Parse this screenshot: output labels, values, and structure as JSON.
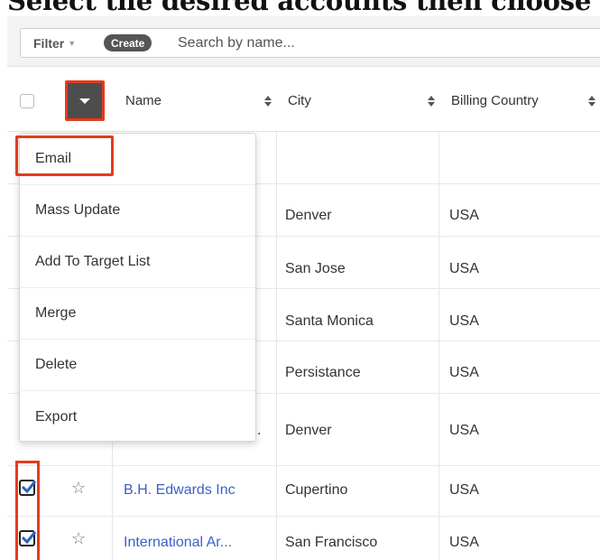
{
  "caption": "Select the desired accounts then choose",
  "toolbar": {
    "filter_label": "Filter",
    "create_label": "Create",
    "search_placeholder": "Search by name..."
  },
  "columns": {
    "name": "Name",
    "city": "City",
    "country": "Billing Country"
  },
  "mass_actions_menu": [
    "Email",
    "Mass Update",
    "Add To Target List",
    "Merge",
    "Delete",
    "Export"
  ],
  "rows": [
    {
      "name": "",
      "city": "Denver",
      "country": "USA"
    },
    {
      "name": "",
      "city": "San Jose",
      "country": "USA"
    },
    {
      "name": "",
      "city": "Santa Monica",
      "country": "USA"
    },
    {
      "name": "",
      "city": "Persistance",
      "country": "USA"
    },
    {
      "name": ".",
      "city": "Denver",
      "country": "USA"
    },
    {
      "name": "B.H. Edwards Inc",
      "city": "Cupertino",
      "country": "USA",
      "checked": true
    },
    {
      "name": "International Ar...",
      "city": "San Francisco",
      "country": "USA",
      "checked": true
    }
  ],
  "colors": {
    "highlight": "#e53a1e",
    "link": "#3b5fc8",
    "toggle": "#4d4d4d"
  }
}
